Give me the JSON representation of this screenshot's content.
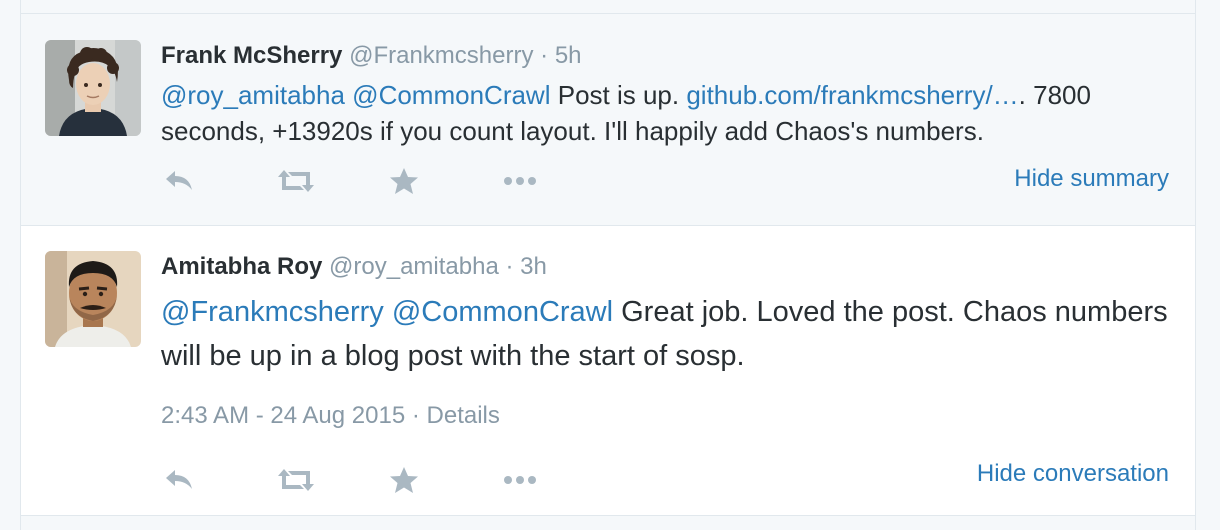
{
  "tweets": [
    {
      "fullname": "Frank McSherry",
      "handle": "@Frankmcsherry",
      "time": "5h",
      "segments": [
        {
          "text": "@roy_amitabha",
          "kind": "mention"
        },
        {
          "text": " ",
          "kind": "plain"
        },
        {
          "text": "@CommonCrawl",
          "kind": "mention"
        },
        {
          "text": " Post is up. ",
          "kind": "plain"
        },
        {
          "text": "github.com/frankmcsherry/…",
          "kind": "link"
        },
        {
          "text": ". 7800 seconds, +13920s if you count layout. I'll happily add Chaos's numbers.",
          "kind": "plain"
        }
      ],
      "toggle_label": "Hide summary"
    },
    {
      "fullname": "Amitabha Roy",
      "handle": "@roy_amitabha",
      "time": "3h",
      "segments": [
        {
          "text": "@Frankmcsherry",
          "kind": "mention"
        },
        {
          "text": " ",
          "kind": "plain"
        },
        {
          "text": "@CommonCrawl",
          "kind": "mention"
        },
        {
          "text": " Great job. Loved the post. Chaos numbers will be up in a blog post with the start of sosp.",
          "kind": "plain"
        }
      ],
      "timestamp": "2:43 AM - 24 Aug 2015",
      "details_label": "Details",
      "toggle_label": "Hide conversation"
    }
  ],
  "separator": "·",
  "action_icons": [
    "reply-icon",
    "retweet-icon",
    "favorite-star-icon",
    "more-icon"
  ],
  "colors": {
    "link": "#2b7bb9",
    "muted": "#8899a6",
    "icon": "#aab8c2",
    "text": "#292f33",
    "summary_bg": "#f5f8fa"
  }
}
